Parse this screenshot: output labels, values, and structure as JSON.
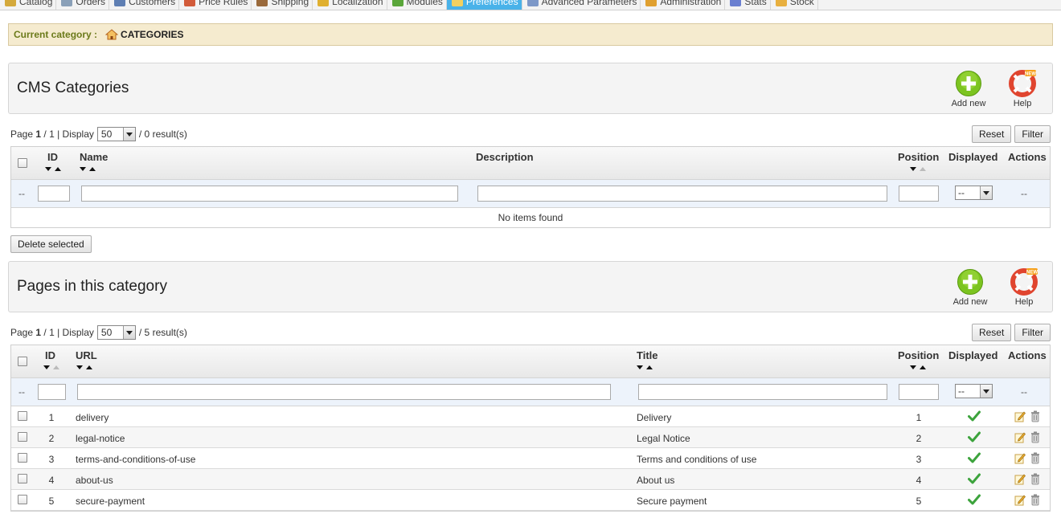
{
  "nav": {
    "tabs": [
      {
        "label": "Catalog",
        "color": "#d4a93c"
      },
      {
        "label": "Orders",
        "color": "#8aa0b8"
      },
      {
        "label": "Customers",
        "color": "#5f7fb3"
      },
      {
        "label": "Price Rules",
        "color": "#d25b3a"
      },
      {
        "label": "Shipping",
        "color": "#9a6a3c"
      },
      {
        "label": "Localization",
        "color": "#e0b030"
      },
      {
        "label": "Modules",
        "color": "#5aa63a"
      },
      {
        "label": "Preferences",
        "color": "#f2d060"
      },
      {
        "label": "Advanced Parameters",
        "color": "#7d98c8"
      },
      {
        "label": "Administration",
        "color": "#e0a030"
      },
      {
        "label": "Stats",
        "color": "#6a7fd0"
      },
      {
        "label": "Stock",
        "color": "#e8b040"
      }
    ],
    "active_tab": "Preferences"
  },
  "breadcrumb": {
    "label": "Current category :",
    "category": "CATEGORIES",
    "icon": "home-icon"
  },
  "cms_categories": {
    "title": "CMS Categories",
    "add_label": "Add new",
    "help_label": "Help",
    "pager": {
      "page_word": "Page",
      "current_page": "1",
      "total_pages": "/ 1",
      "display_word": "| Display",
      "per_page": "50",
      "results": "/ 0 result(s)"
    },
    "reset_label": "Reset",
    "filter_label": "Filter",
    "columns": {
      "id": "ID",
      "name": "Name",
      "description": "Description",
      "position": "Position",
      "displayed": "Displayed",
      "actions": "Actions"
    },
    "filter_dash": "--",
    "displayed_filter": "--",
    "actions_dash": "--",
    "empty_message": "No items found"
  },
  "delete_selected_label": "Delete selected",
  "pages": {
    "title": "Pages in this category",
    "add_label": "Add new",
    "help_label": "Help",
    "pager": {
      "page_word": "Page",
      "current_page": "1",
      "total_pages": "/ 1",
      "display_word": "| Display",
      "per_page": "50",
      "results": "/ 5 result(s)"
    },
    "reset_label": "Reset",
    "filter_label": "Filter",
    "columns": {
      "id": "ID",
      "url": "URL",
      "title": "Title",
      "position": "Position",
      "displayed": "Displayed",
      "actions": "Actions"
    },
    "filter_dash": "--",
    "displayed_filter": "--",
    "actions_dash": "--",
    "rows": [
      {
        "id": "1",
        "url": "delivery",
        "title": "Delivery",
        "position": "1",
        "displayed": true
      },
      {
        "id": "2",
        "url": "legal-notice",
        "title": "Legal Notice",
        "position": "2",
        "displayed": true
      },
      {
        "id": "3",
        "url": "terms-and-conditions-of-use",
        "title": "Terms and conditions of use",
        "position": "3",
        "displayed": true
      },
      {
        "id": "4",
        "url": "about-us",
        "title": "About us",
        "position": "4",
        "displayed": true
      },
      {
        "id": "5",
        "url": "secure-payment",
        "title": "Secure payment",
        "position": "5",
        "displayed": true
      }
    ]
  },
  "colors": {
    "add_green": "#7cc420",
    "help_red": "#e0452f",
    "check_green": "#3ca33c",
    "active_tab_blue": "#49b2e9"
  }
}
